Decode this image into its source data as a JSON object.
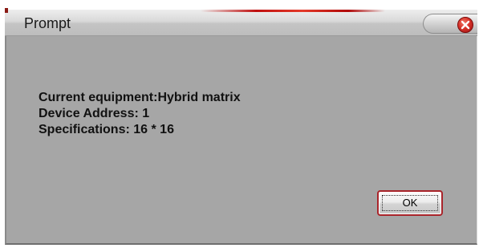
{
  "window": {
    "title": "Prompt"
  },
  "message": {
    "lines": [
      "Current equipment:Hybrid matrix",
      "Device Address: 1",
      "Specifications: 16 * 16"
    ]
  },
  "buttons": {
    "ok_label": "OK"
  },
  "icons": {
    "close": "close-icon"
  },
  "colors": {
    "dialog_background": "#a6a6a6",
    "title_accent": "#c01010",
    "close_button": "#d8332a",
    "ok_border": "#a8242a"
  }
}
